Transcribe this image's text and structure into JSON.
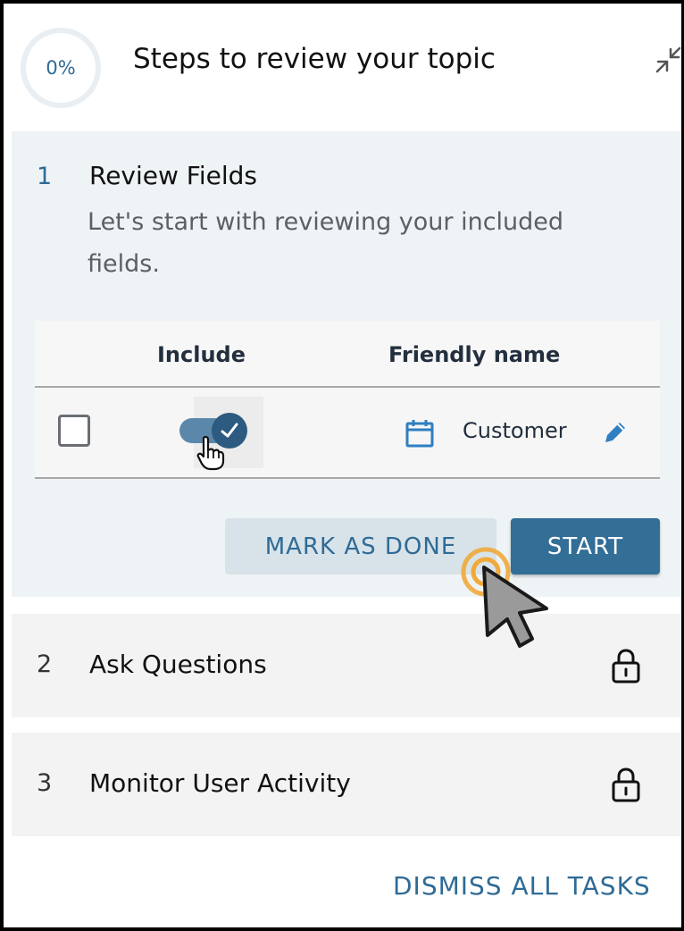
{
  "header": {
    "progress_text": "0%",
    "progress_value": 0,
    "title": "Steps to review your topic",
    "collapse_icon": "collapse-arrows-icon"
  },
  "steps": [
    {
      "number": "1",
      "title": "Review Fields",
      "description": "Let's start with reviewing your included fields.",
      "expanded": true,
      "table": {
        "columns": [
          "",
          "Include",
          "Friendly name"
        ],
        "rows": [
          {
            "selected": false,
            "include": true,
            "type_icon": "calendar-icon",
            "friendly_name": "Customer",
            "edit_icon": "pencil-icon"
          }
        ]
      },
      "actions": {
        "mark_done": "MARK AS DONE",
        "start": "START"
      }
    },
    {
      "number": "2",
      "title": "Ask Questions",
      "locked": true,
      "lock_icon": "lock-icon"
    },
    {
      "number": "3",
      "title": "Monitor User Activity",
      "locked": true,
      "lock_icon": "lock-icon"
    }
  ],
  "footer": {
    "dismiss_label": "DISMISS ALL TASKS"
  },
  "colors": {
    "accent": "#2f6b96",
    "primary_button": "#336e97",
    "secondary_button": "#d8e3e9",
    "toggle_on": "#2c5a80",
    "active_step_bg": "#eef3f5",
    "locked_step_bg": "#f3f3f3",
    "click_indicator": "#f0a93a"
  }
}
